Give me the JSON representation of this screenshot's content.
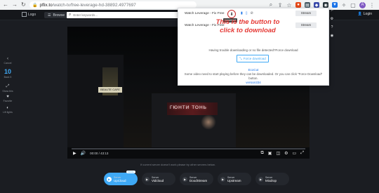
{
  "browser": {
    "url_host": "pflix.to",
    "url_path": "/watch-tv/free-leverage-hd-38892.4977697"
  },
  "site": {
    "logo": "Logo",
    "browse": "Browse",
    "search_placeholder": "Enter keywords...",
    "login": "Login"
  },
  "rail": [
    {
      "icon": "‹",
      "label": "Cancel"
    },
    {
      "icon": "10",
      "label": "Back 5"
    },
    {
      "icon": "⤢",
      "label": "Show this"
    },
    {
      "icon": "♥",
      "label": "Favorite"
    },
    {
      "icon": "◐",
      "label": "Lift lights"
    }
  ],
  "player": {
    "time": "00:00 / 43:13",
    "progress": 0.0,
    "sign_text": "ГЮНТИ ТОНЬ",
    "poster_text": "BEAUTE CAFE"
  },
  "servers_note": "If current server doesn't work please try other servers below.",
  "servers": [
    {
      "label_top": "Server",
      "label": "UpCloud",
      "active": true,
      "badge": "Mobile"
    },
    {
      "label_top": "Server",
      "label": "Vidcloud",
      "active": false
    },
    {
      "label_top": "Server",
      "label": "DoodStream",
      "active": false
    },
    {
      "label_top": "Server",
      "label": "Upstream",
      "active": false
    },
    {
      "label_top": "Server",
      "label": "Mixdrop",
      "active": false
    }
  ],
  "popup": {
    "rows": [
      {
        "title": "Watch Leverage - Fix Free",
        "type": "Stream"
      },
      {
        "title": "Watch Leverage - Fix Free",
        "type": "Stream"
      }
    ],
    "tooltip": "Download",
    "annotation_line1": "This is the button to",
    "annotation_line2": "click to download",
    "trouble_text": "Having trouble downloading or no file detected?Force download",
    "force_button": "Force download",
    "ecocut": "EcoCut",
    "support_text": "Some video need to start playing before they can be downloaded. Or you can click \"Force Download\" button.",
    "version": "version334"
  },
  "colors": {
    "accent": "#3fa9f5",
    "annotation": "#e53935",
    "page_bg": "#1b1d22"
  }
}
